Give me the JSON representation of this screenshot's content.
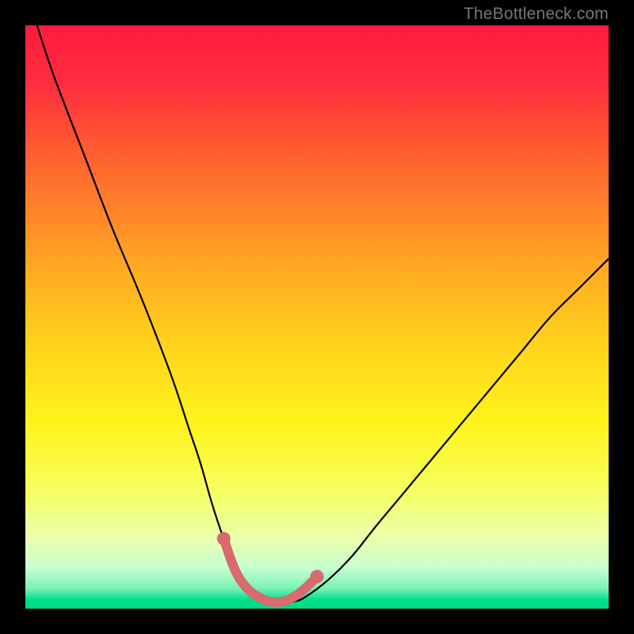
{
  "watermark": "TheBottleneck.com",
  "chart_data": {
    "type": "line",
    "title": "",
    "xlabel": "",
    "ylabel": "",
    "xlim": [
      0,
      100
    ],
    "ylim": [
      0,
      100
    ],
    "series": [
      {
        "name": "curve",
        "x": [
          2,
          5,
          10,
          15,
          20,
          25,
          28,
          30,
          32,
          34,
          36,
          38,
          40,
          42,
          44,
          46,
          48,
          52,
          56,
          60,
          65,
          70,
          75,
          80,
          85,
          90,
          95,
          100
        ],
        "y": [
          100,
          91,
          78,
          65,
          53,
          40,
          31,
          25,
          18,
          12,
          7,
          4,
          2,
          1.2,
          1,
          1.2,
          2,
          5,
          9,
          14,
          20,
          26,
          32,
          38,
          44,
          50,
          55,
          60
        ]
      },
      {
        "name": "highlight",
        "x": [
          34,
          36,
          38,
          40,
          42,
          44,
          46,
          48,
          50
        ],
        "y": [
          12,
          6.5,
          3.5,
          2,
          1.2,
          1.2,
          2,
          3.5,
          5.5
        ]
      }
    ],
    "gradient_stops": [
      {
        "offset": 0.0,
        "color": "#ff1a3e"
      },
      {
        "offset": 0.1,
        "color": "#ff2e3e"
      },
      {
        "offset": 0.25,
        "color": "#ff6a2e"
      },
      {
        "offset": 0.4,
        "color": "#ffa423"
      },
      {
        "offset": 0.55,
        "color": "#ffd41c"
      },
      {
        "offset": 0.68,
        "color": "#fff31a"
      },
      {
        "offset": 0.8,
        "color": "#f6ff63"
      },
      {
        "offset": 0.88,
        "color": "#eaffad"
      },
      {
        "offset": 0.93,
        "color": "#c6ffd0"
      },
      {
        "offset": 0.965,
        "color": "#7cf2b6"
      },
      {
        "offset": 0.985,
        "color": "#00e08a"
      },
      {
        "offset": 1.0,
        "color": "#00d884"
      }
    ],
    "curve_color": "#000000",
    "highlight_color": "#d96a6e"
  }
}
